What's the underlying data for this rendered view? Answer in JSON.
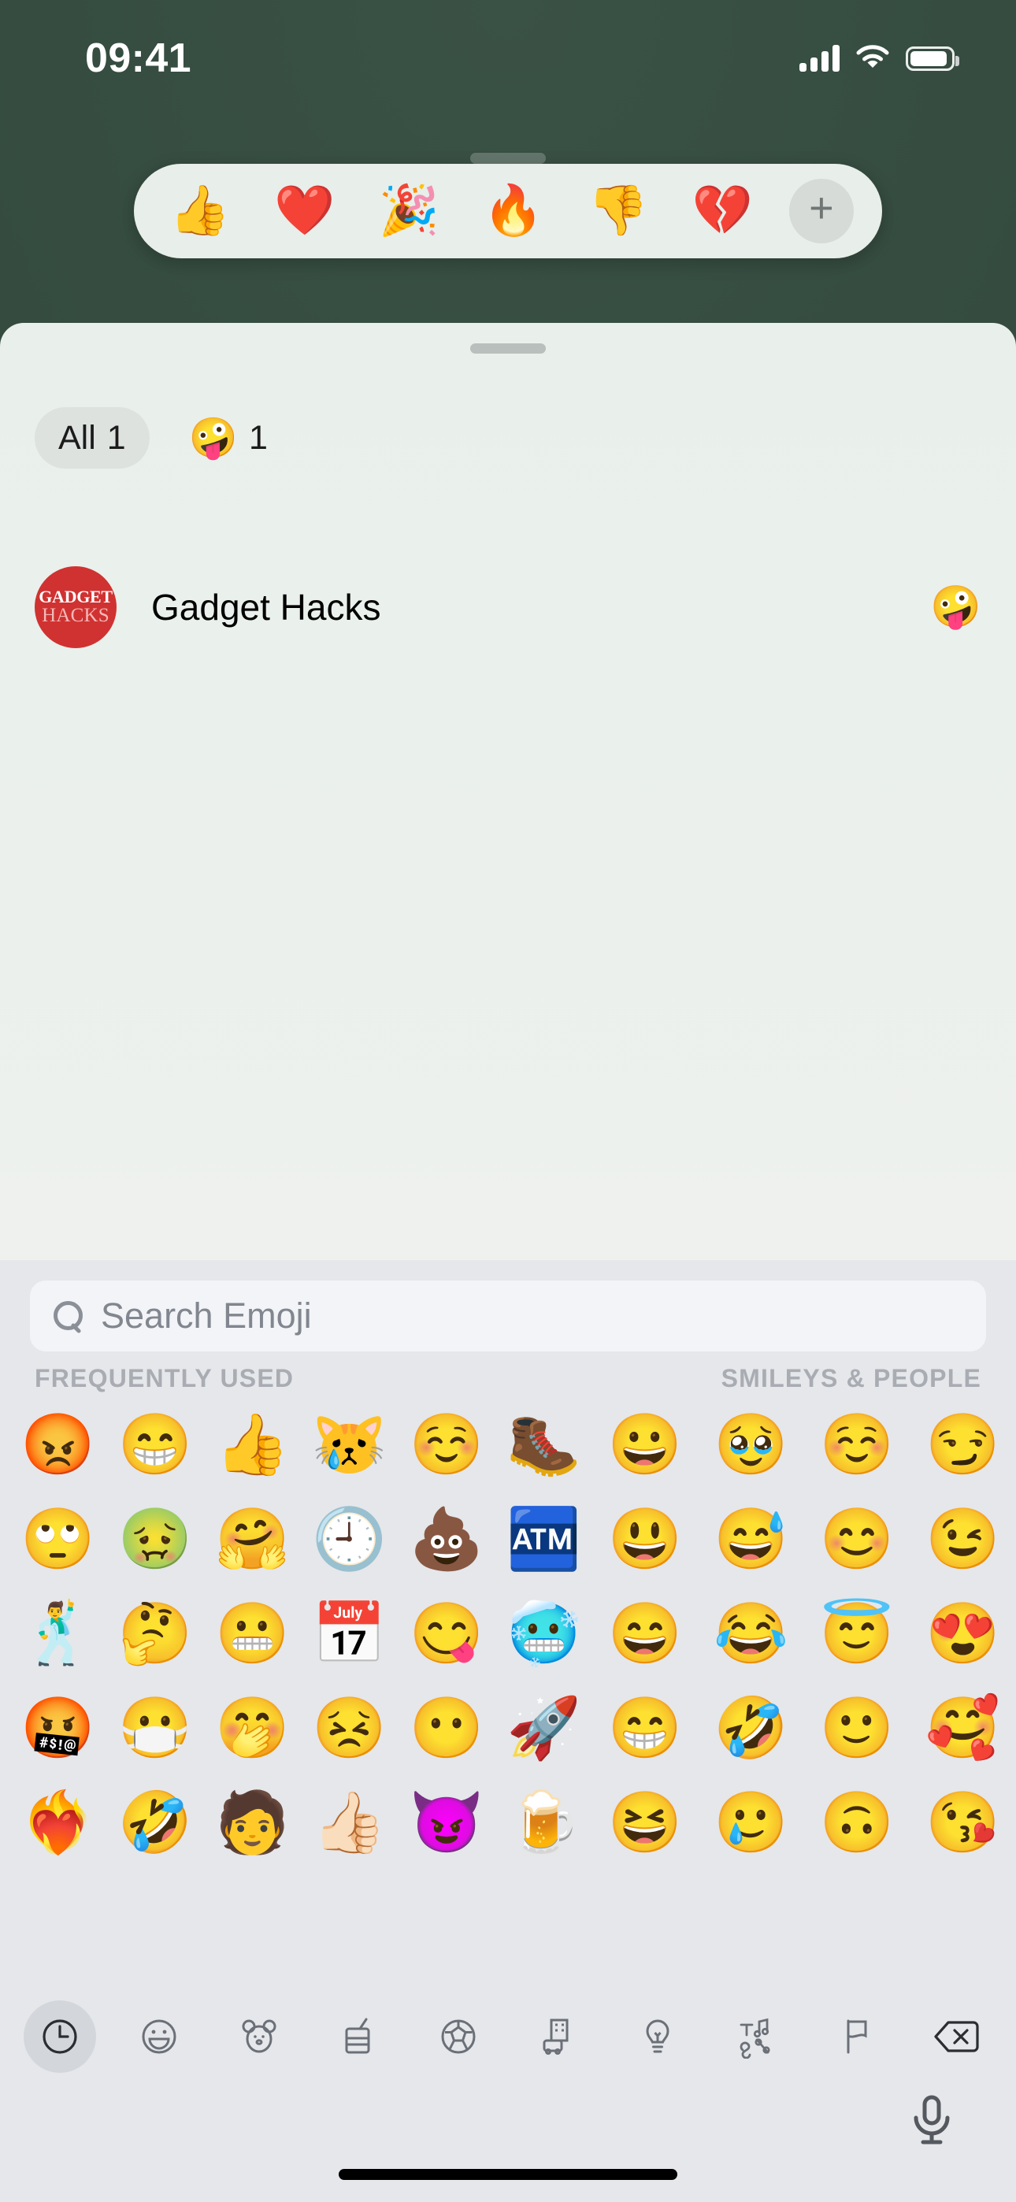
{
  "status_bar": {
    "time": "09:41",
    "icons": [
      "cellular-signal-icon",
      "wifi-icon",
      "battery-icon"
    ],
    "cellular_bars": 4,
    "battery_level_pct": 92
  },
  "tapback_bar": {
    "reactions": [
      {
        "name": "thumbs-up",
        "glyph": "👍"
      },
      {
        "name": "red-heart",
        "glyph": "❤️"
      },
      {
        "name": "party-popper",
        "glyph": "🎉"
      },
      {
        "name": "fire",
        "glyph": "🔥"
      },
      {
        "name": "thumbs-down",
        "glyph": "👎"
      },
      {
        "name": "broken-heart",
        "glyph": "💔"
      }
    ],
    "more_label": "+"
  },
  "sheet": {
    "filters": [
      {
        "name": "all",
        "label": "All",
        "count": "1"
      },
      {
        "name": "zany-face",
        "emoji": "🤪",
        "count": "1"
      }
    ],
    "reactors": [
      {
        "name": "Gadget Hacks",
        "avatar_top": "GADGET",
        "avatar_bottom": "HACKS",
        "avatar_color": "#d03231",
        "reaction": "🤪"
      }
    ]
  },
  "keyboard": {
    "search": {
      "placeholder": "Search Emoji",
      "value": ""
    },
    "sections": [
      {
        "name": "frequently-used",
        "title": "FREQUENTLY USED"
      },
      {
        "name": "smileys-and-people",
        "title": "SMILEYS & PEOPLE"
      }
    ],
    "frequently_used": [
      "😡",
      "😁",
      "👍",
      "😿",
      "☺️",
      "🥾",
      "🙄",
      "🤢",
      "🤗",
      "🕘",
      "💩",
      "🏧",
      "🕺",
      "🤔",
      "😬",
      "📅",
      "😋",
      "🥶",
      "🤬",
      "😷",
      "🤭",
      "😣",
      "😶",
      "🚀",
      "❤️‍🔥",
      "🤣",
      "🧑",
      "👍🏻",
      "😈",
      "🍺"
    ],
    "smileys_and_people": [
      "😀",
      "🥹",
      "☺️",
      "😏",
      "😃",
      "😅",
      "😊",
      "😉",
      "😄",
      "😂",
      "😇",
      "😍",
      "😁",
      "🤣",
      "🙂",
      "🥰",
      "😆",
      "🥲",
      "🙃",
      "😘"
    ],
    "categories": [
      {
        "name": "recents",
        "icon": "clock-icon",
        "selected": true
      },
      {
        "name": "smileys",
        "icon": "smiley-icon",
        "selected": false
      },
      {
        "name": "animals",
        "icon": "animal-icon",
        "selected": false
      },
      {
        "name": "food",
        "icon": "food-icon",
        "selected": false
      },
      {
        "name": "activity",
        "icon": "soccer-ball-icon",
        "selected": false
      },
      {
        "name": "travel",
        "icon": "travel-building-icon",
        "selected": false
      },
      {
        "name": "objects",
        "icon": "lightbulb-icon",
        "selected": false
      },
      {
        "name": "symbols",
        "icon": "symbols-icon",
        "selected": false
      },
      {
        "name": "flags",
        "icon": "flag-icon",
        "selected": false
      },
      {
        "name": "delete",
        "icon": "backspace-icon",
        "selected": false
      }
    ],
    "dictation": {
      "name": "microphone",
      "icon": "microphone-icon"
    }
  },
  "colors": {
    "backdrop": "#344a3e",
    "sheet_bg": "#e9efeb",
    "keyboard_bg": "#e5e7ea",
    "accent_red": "#d03231",
    "search_bg": "#f2f4f7",
    "section_title": "#a9acb3"
  }
}
